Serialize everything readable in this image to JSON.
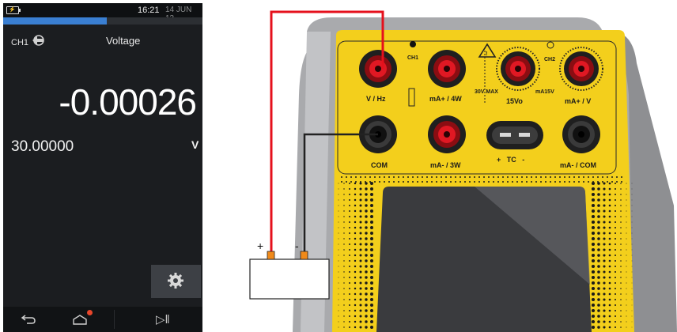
{
  "status_bar": {
    "time": "16:21",
    "date": "14 JUN 13",
    "battery_icon": "battery-icon",
    "progress_percent": 52
  },
  "channel": {
    "label": "CH1",
    "icon": "channel-arrow-icon"
  },
  "function": {
    "title": "Voltage"
  },
  "measurement": {
    "reading": "-0.00026",
    "range": "30.00000",
    "unit": "V"
  },
  "settings_button": {
    "icon": "gear-icon"
  },
  "nav": {
    "back_icon": "back-arrow-icon",
    "home_icon": "home-icon",
    "play_pause_icon": "play-pause-icon",
    "notification_color": "#e8462b"
  },
  "device": {
    "jacks_top": [
      "V / Hz",
      "mA+ / 4W",
      "15Vo",
      "mA+ / V"
    ],
    "jacks_bottom": [
      "COM",
      "mA- / 3W",
      "+   TC   -",
      "mA- / COM"
    ],
    "ch1_label": "CH1",
    "ch2_label": "CH2",
    "warning_label": "30V MAX",
    "ma_label": "mA15V",
    "body_color": "#f3cf1c",
    "lead_colors": {
      "positive": "#e5101c",
      "negative": "#222222"
    }
  },
  "source": {
    "plus_label": "+",
    "minus_label": "-"
  }
}
